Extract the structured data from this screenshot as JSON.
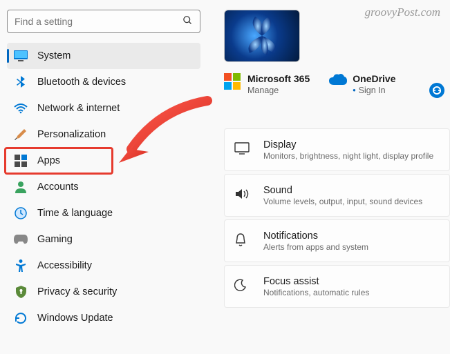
{
  "watermark": "groovyPost.com",
  "search": {
    "placeholder": "Find a setting"
  },
  "nav": [
    {
      "id": "system",
      "label": "System",
      "icon": "monitor-icon",
      "selected": true
    },
    {
      "id": "bluetooth",
      "label": "Bluetooth & devices",
      "icon": "bluetooth-icon",
      "selected": false
    },
    {
      "id": "network",
      "label": "Network & internet",
      "icon": "wifi-icon",
      "selected": false
    },
    {
      "id": "personalize",
      "label": "Personalization",
      "icon": "brush-icon",
      "selected": false
    },
    {
      "id": "apps",
      "label": "Apps",
      "icon": "apps-icon",
      "selected": false
    },
    {
      "id": "accounts",
      "label": "Accounts",
      "icon": "person-icon",
      "selected": false
    },
    {
      "id": "time",
      "label": "Time & language",
      "icon": "clock-icon",
      "selected": false
    },
    {
      "id": "gaming",
      "label": "Gaming",
      "icon": "gamepad-icon",
      "selected": false
    },
    {
      "id": "accessibility",
      "label": "Accessibility",
      "icon": "accessibility-icon",
      "selected": false
    },
    {
      "id": "privacy",
      "label": "Privacy & security",
      "icon": "shield-icon",
      "selected": false
    },
    {
      "id": "update",
      "label": "Windows Update",
      "icon": "update-icon",
      "selected": false
    }
  ],
  "services": {
    "ms365": {
      "title": "Microsoft 365",
      "subtitle": "Manage"
    },
    "onedrive": {
      "title": "OneDrive",
      "subtitle": "Sign In"
    }
  },
  "cards": [
    {
      "id": "display",
      "title": "Display",
      "subtitle": "Monitors, brightness, night light, display profile",
      "icon": "display-icon"
    },
    {
      "id": "sound",
      "title": "Sound",
      "subtitle": "Volume levels, output, input, sound devices",
      "icon": "sound-icon"
    },
    {
      "id": "notif",
      "title": "Notifications",
      "subtitle": "Alerts from apps and system",
      "icon": "bell-icon"
    },
    {
      "id": "focus",
      "title": "Focus assist",
      "subtitle": "Notifications, automatic rules",
      "icon": "moon-icon"
    }
  ],
  "annotation": {
    "highlight_target": "apps",
    "color": "#e63b2e"
  }
}
